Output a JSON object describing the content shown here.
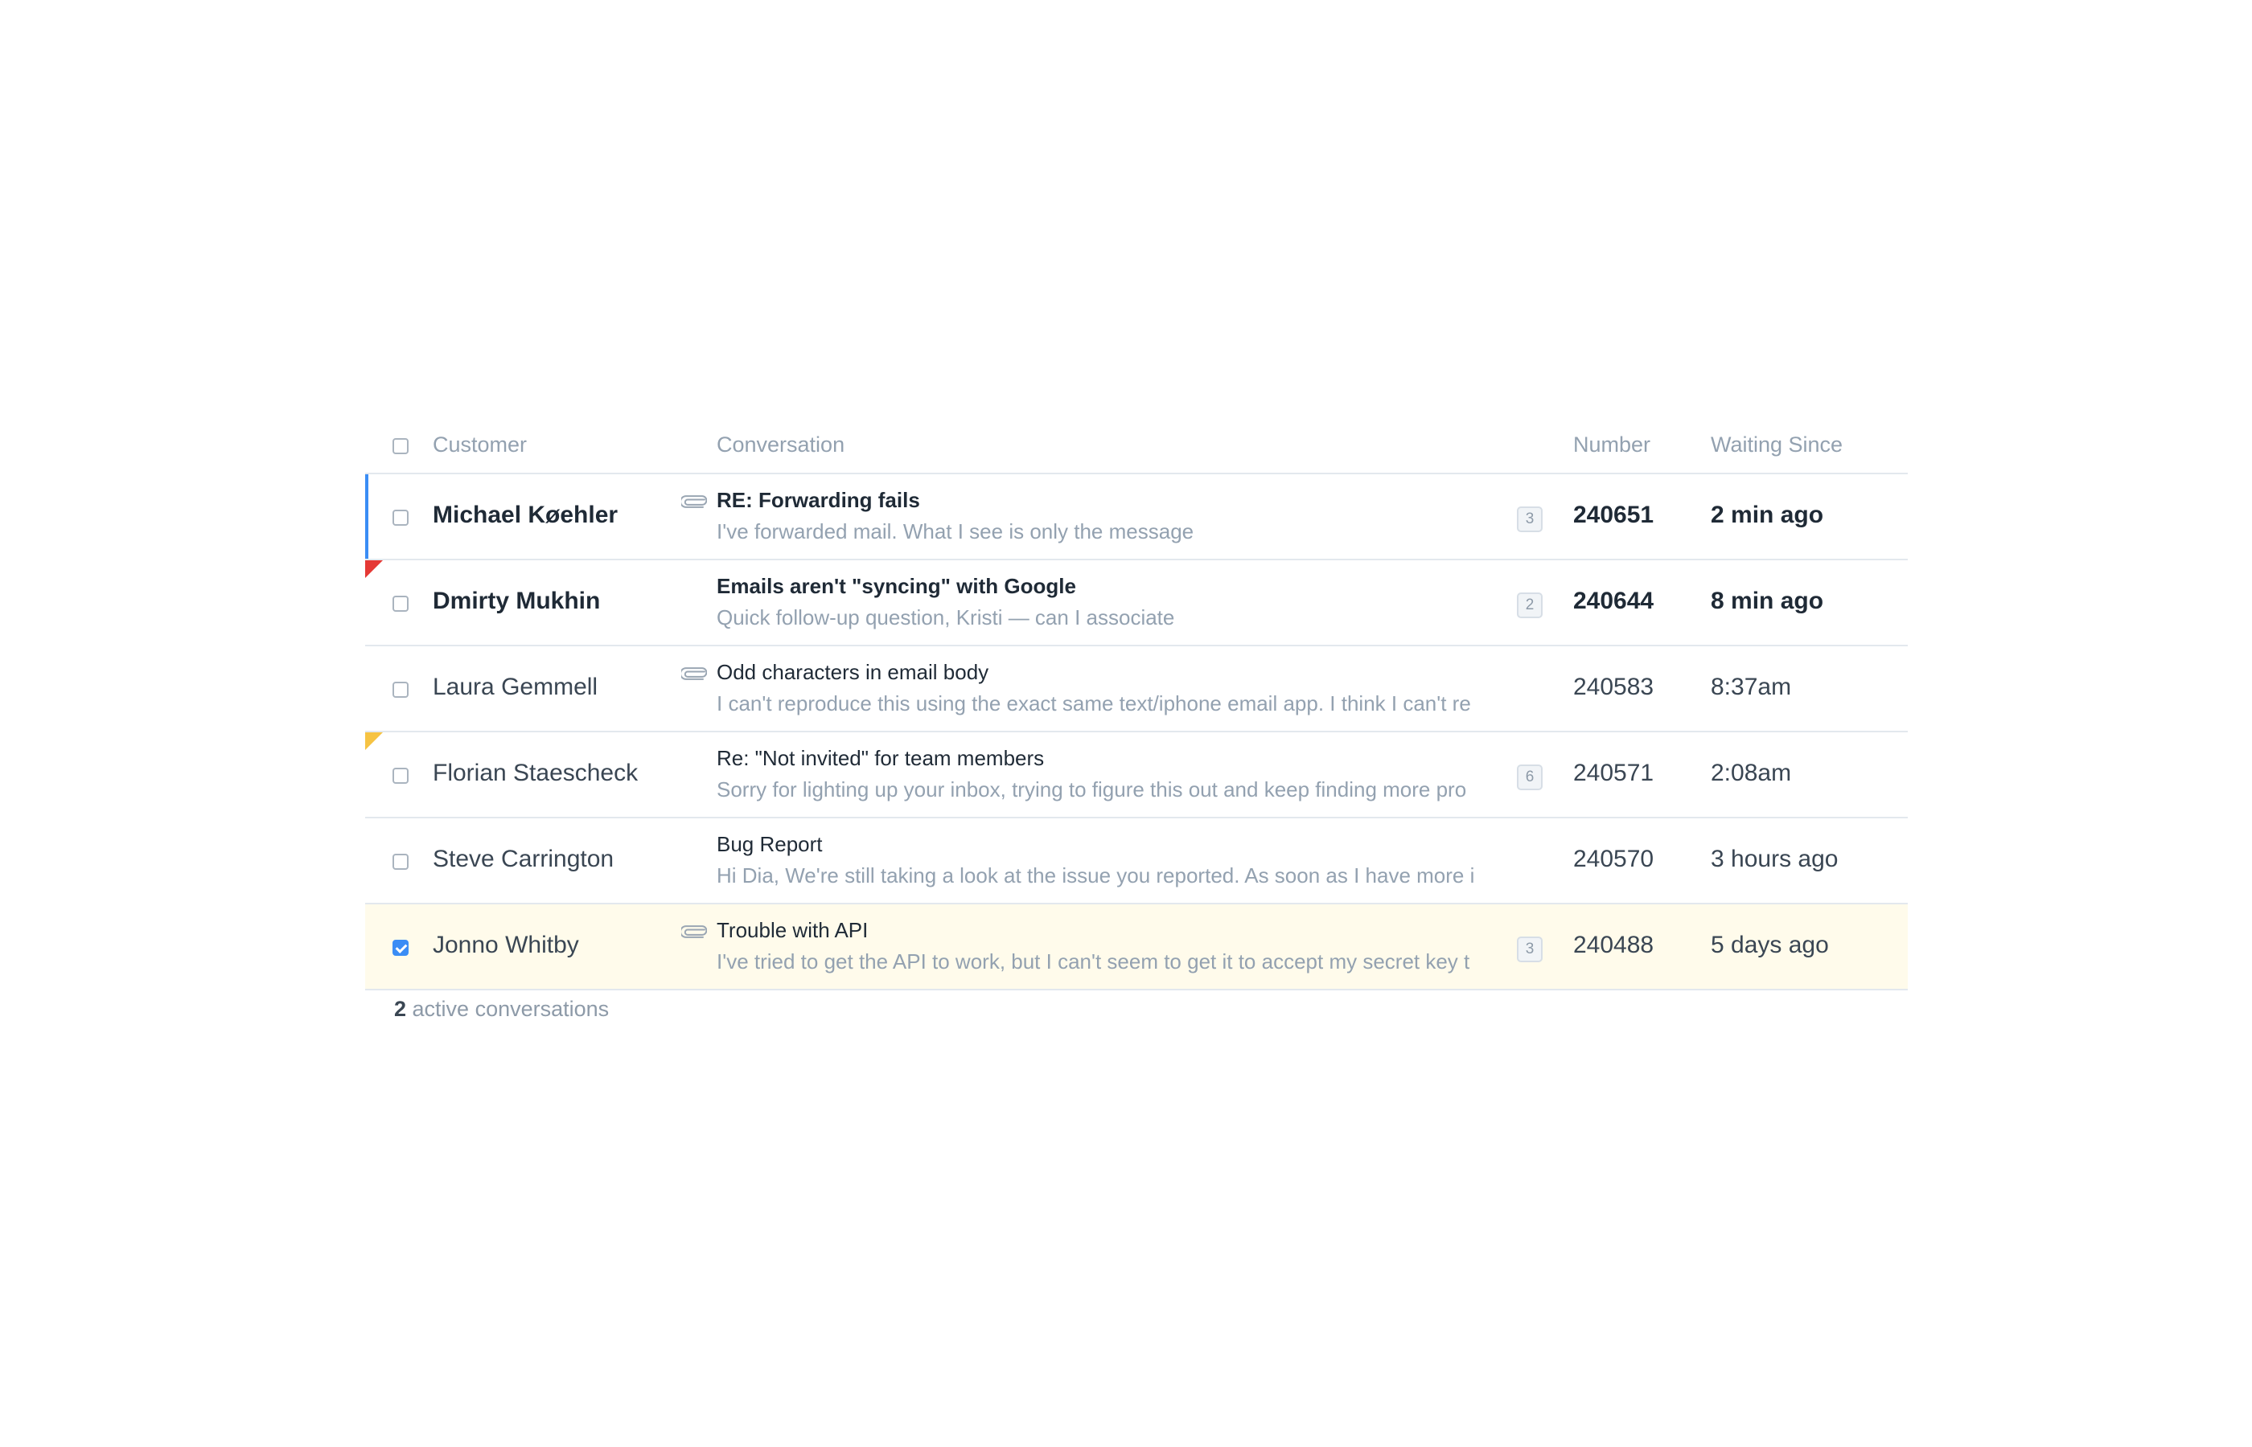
{
  "header": {
    "customer": "Customer",
    "conversation": "Conversation",
    "number": "Number",
    "waiting": "Waiting Since"
  },
  "rows": [
    {
      "customer": "Michael Køehler",
      "subject": "RE: Forwarding fails",
      "preview": "I've forwarded mail. What I see is only the message",
      "count": "3",
      "number": "240651",
      "waiting": "2 min ago",
      "unread": true,
      "attachment": true,
      "active": true,
      "flag": "",
      "checked": false
    },
    {
      "customer": "Dmirty Mukhin",
      "subject": "Emails aren't \"syncing\" with Google",
      "preview": "Quick follow-up question, Kristi — can I associate",
      "count": "2",
      "number": "240644",
      "waiting": "8 min ago",
      "unread": true,
      "attachment": false,
      "active": false,
      "flag": "red",
      "checked": false
    },
    {
      "customer": "Laura Gemmell",
      "subject": "Odd characters in email body",
      "preview": "I can't reproduce this using the exact same text/iphone email app. I think I can't re",
      "count": "",
      "number": "240583",
      "waiting": "8:37am",
      "unread": false,
      "attachment": true,
      "active": false,
      "flag": "",
      "checked": false
    },
    {
      "customer": "Florian Staescheck",
      "subject": "Re: \"Not invited\" for team members",
      "preview": "Sorry for lighting up your inbox, trying to figure this out and keep finding more pro",
      "count": "6",
      "number": "240571",
      "waiting": "2:08am",
      "unread": false,
      "attachment": false,
      "active": false,
      "flag": "yellow",
      "checked": false
    },
    {
      "customer": "Steve Carrington",
      "subject": "Bug Report",
      "preview": "Hi Dia, We're still taking a look at the issue you reported. As soon as I have more i",
      "count": "",
      "number": "240570",
      "waiting": "3 hours ago",
      "unread": false,
      "attachment": false,
      "active": false,
      "flag": "",
      "checked": false
    },
    {
      "customer": "Jonno Whitby",
      "subject": "Trouble with API",
      "preview": "I've tried to get the API to work, but I can't seem to get it to accept my secret key t",
      "count": "3",
      "number": "240488",
      "waiting": "5 days ago",
      "unread": false,
      "attachment": true,
      "active": false,
      "flag": "",
      "checked": true
    }
  ],
  "footer": {
    "count": "2",
    "label": " active conversations"
  },
  "colors": {
    "accent": "#3b8df5",
    "flag_red": "#e53935",
    "flag_yellow": "#f6c343",
    "selected_row": "#fffbeb"
  }
}
